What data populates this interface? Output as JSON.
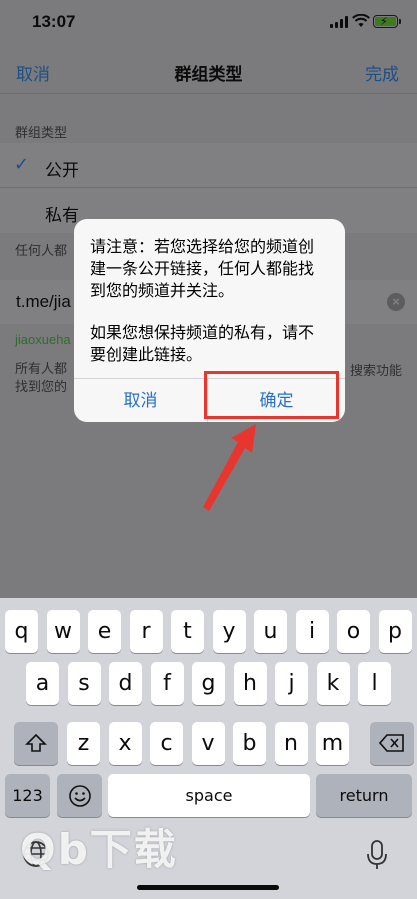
{
  "status": {
    "time": "13:07"
  },
  "nav": {
    "cancel": "取消",
    "title": "群组类型",
    "done": "完成"
  },
  "settings": {
    "section_header": "群组类型",
    "options": [
      {
        "label": "公开",
        "selected": true
      },
      {
        "label": "私有",
        "selected": false
      }
    ],
    "desc_partial": "任何人都",
    "link_prefix": "t.me/jia",
    "link_status": "jiaoxueha",
    "desc2_left": "所有人都 找到您的",
    "desc2_right": "搜索功能"
  },
  "alert": {
    "line1": "请注意：若您选择给您的频道创建一条公开链接，任何人都能找到您的频道并关注。",
    "line2": "如果您想保持频道的私有，请不要创建此链接。",
    "cancel": "取消",
    "confirm": "确定"
  },
  "annotation": {
    "color": "#e8362f"
  },
  "keyboard": {
    "row1": [
      "q",
      "w",
      "e",
      "r",
      "t",
      "y",
      "u",
      "i",
      "o",
      "p"
    ],
    "row2": [
      "a",
      "s",
      "d",
      "f",
      "g",
      "h",
      "j",
      "k",
      "l"
    ],
    "row3": [
      "z",
      "x",
      "c",
      "v",
      "b",
      "n",
      "m"
    ],
    "numbers": "123",
    "space": "space",
    "return": "return"
  },
  "watermark": "Qb下载"
}
